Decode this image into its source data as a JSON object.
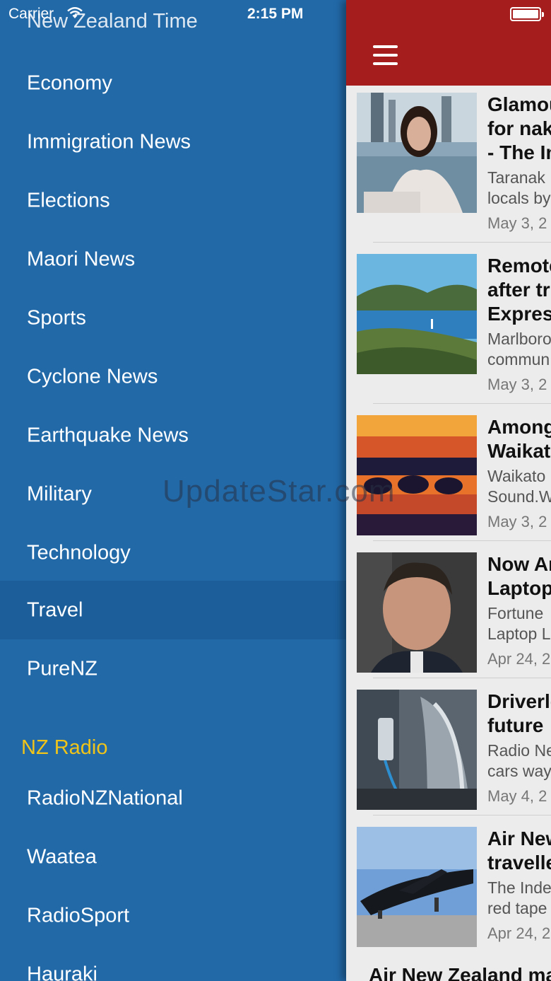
{
  "status_bar": {
    "carrier": "Carrier",
    "time": "2:15 PM"
  },
  "menu": {
    "top_partial_item": "New Zealand Time",
    "items": [
      {
        "label": "Economy"
      },
      {
        "label": "Immigration News"
      },
      {
        "label": "Elections"
      },
      {
        "label": "Maori News"
      },
      {
        "label": "Sports"
      },
      {
        "label": "Cyclone News"
      },
      {
        "label": "Earthquake News"
      },
      {
        "label": "Military"
      },
      {
        "label": "Technology"
      },
      {
        "label": "Travel",
        "selected": true
      },
      {
        "label": "PureNZ"
      }
    ],
    "radio_section": {
      "header": "NZ Radio",
      "items": [
        {
          "label": "RadioNZNational"
        },
        {
          "label": "Waatea"
        },
        {
          "label": "RadioSport"
        },
        {
          "label": "Hauraki"
        }
      ]
    }
  },
  "articles": [
    {
      "title_line1": "Glamou",
      "title_line2": "for nak",
      "title_line3": "- The In",
      "desc_line1": "Taranak",
      "desc_line2": "locals by",
      "date": "May 3, 2"
    },
    {
      "title_line1": "Remote",
      "title_line2": "after tr",
      "title_line3": "Express",
      "desc_line1": "Marlboro",
      "desc_line2": "commun",
      "date": "May 3, 2"
    },
    {
      "title_line1": "Among",
      "title_line2": "Waikat",
      "desc_line1": "Waikato",
      "desc_line2": "Sound.W",
      "date": "May 3, 2"
    },
    {
      "title_line1": "Now Ar",
      "title_line2": "Laptop",
      "desc_line1": "Fortune",
      "desc_line2": "Laptop L",
      "date": "Apr 24, 2"
    },
    {
      "title_line1": "Driverle",
      "title_line2": "future",
      "desc_line1": "Radio Ne",
      "desc_line2": "cars way",
      "date": "May 4, 2"
    },
    {
      "title_line1": "Air New",
      "title_line2": "travelle",
      "desc_line1": "The Inde",
      "desc_line2": "red tape",
      "date": "Apr 24, 2"
    }
  ],
  "bottom_article_title": "Air New Zealand ma",
  "watermark": "UpdateStar.com",
  "colors": {
    "menu_bg": "#2269a8",
    "selected_bg": "#1c5e9a",
    "section_header": "#f0c419",
    "navbar": "#a51d1d"
  }
}
